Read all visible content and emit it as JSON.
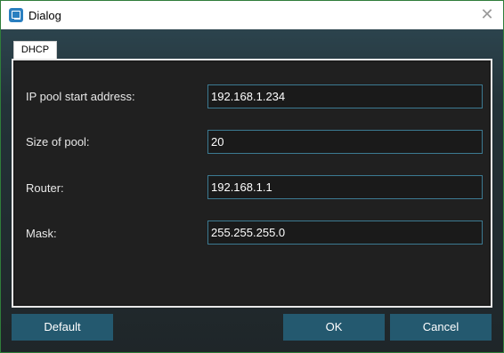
{
  "window": {
    "title": "Dialog"
  },
  "tabs": [
    {
      "label": "DHCP"
    }
  ],
  "fields": [
    {
      "label": "IP pool start address:",
      "value": "192.168.1.234"
    },
    {
      "label": "Size of pool:",
      "value": "20"
    },
    {
      "label": "Router:",
      "value": "192.168.1.1"
    },
    {
      "label": "Mask:",
      "value": "255.255.255.0"
    }
  ],
  "buttons": {
    "default": "Default",
    "ok": "OK",
    "cancel": "Cancel"
  },
  "close_glyph": "✕"
}
